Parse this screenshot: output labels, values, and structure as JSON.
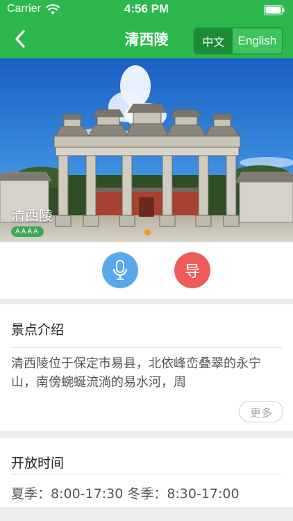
{
  "status_bar": {
    "carrier": "Carrier",
    "time": "4:56 PM",
    "wifi_icon": "wifi-icon",
    "battery_icon": "battery-icon"
  },
  "nav": {
    "back_icon": "chevron-left-icon",
    "title": "清西陵",
    "languages": [
      {
        "label": "中文",
        "selected": true
      },
      {
        "label": "English",
        "selected": false
      }
    ]
  },
  "hero": {
    "caption": "清西陵",
    "rating": "AAAA",
    "carousel_current_index": 1
  },
  "actions": {
    "audio_icon": "microphone-icon",
    "guide_label": "导"
  },
  "intro": {
    "title": "景点介绍",
    "text": "清西陵位于保定市易县，北依峰峦叠翠的永宁山，南傍蜿蜒流淌的易水河，周",
    "more_label": "更多"
  },
  "hours": {
    "title": "开放时间",
    "text": "夏季：8:00-17:30 冬季：8:30-17:00"
  },
  "colors": {
    "brand_green": "#2db84d",
    "audio_blue": "#5aa8ec",
    "guide_red": "#ef5b5b",
    "page_dot": "#f39a1c"
  }
}
